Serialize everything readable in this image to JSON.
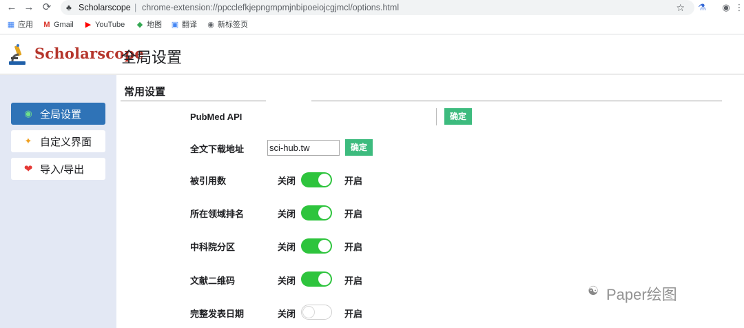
{
  "browser": {
    "tab_origin": "Scholarscope",
    "separator": "|",
    "url": "chrome-extension://ppcclefkjepngmpmjnbipoeiojcgjmcl/options.html",
    "bookmarks": [
      {
        "label": "应用",
        "icon": "apps-grid-icon"
      },
      {
        "label": "Gmail",
        "icon": "gmail-icon"
      },
      {
        "label": "YouTube",
        "icon": "youtube-icon"
      },
      {
        "label": "地图",
        "icon": "maps-icon"
      },
      {
        "label": "翻译",
        "icon": "translate-icon"
      },
      {
        "label": "新标签页",
        "icon": "globe-icon"
      }
    ]
  },
  "header": {
    "brand": "Scholarscope",
    "title": "全局设置"
  },
  "sidebar": {
    "items": [
      {
        "label": "全局设置",
        "icon": "eye-icon",
        "active": true
      },
      {
        "label": "自定义界面",
        "icon": "pin-icon",
        "active": false
      },
      {
        "label": "导入/导出",
        "icon": "heart-icon",
        "active": false
      }
    ]
  },
  "main": {
    "section_title": "常用设置",
    "pubmed": {
      "label": "PubMed API",
      "value": "",
      "button": "确定"
    },
    "download": {
      "label": "全文下载地址",
      "value": "sci-hub.tw",
      "button": "确定"
    },
    "off_label": "关闭",
    "on_label": "开启",
    "toggles": [
      {
        "label": "被引用数",
        "enabled": true
      },
      {
        "label": "所在领域排名",
        "enabled": true
      },
      {
        "label": "中科院分区",
        "enabled": true
      },
      {
        "label": "文献二维码",
        "enabled": true
      },
      {
        "label": "完整发表日期",
        "enabled": false
      }
    ]
  },
  "watermark": "Paper绘图",
  "colors": {
    "brand": "#b5352b",
    "sidebar_active": "#2f73b7",
    "sidebar_bg": "#e3e8f4",
    "confirm_button": "#3dbb7e",
    "switch_on": "#2ec43d"
  }
}
